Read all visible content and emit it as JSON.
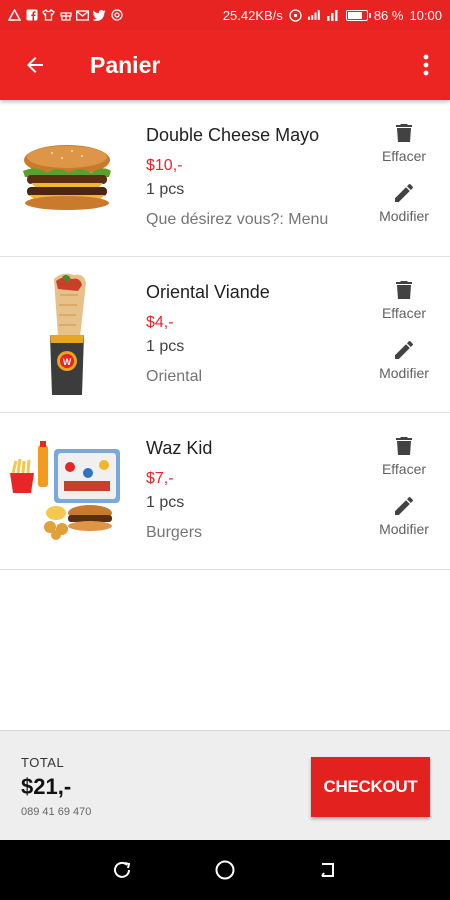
{
  "status_bar": {
    "speed": "25.42KB/s",
    "battery_text": "86 %",
    "battery_level": 0.86,
    "time": "10:00",
    "icons": [
      "warning-icon",
      "facebook-icon",
      "shirt-icon",
      "gift-icon",
      "mail-icon",
      "twitter-icon",
      "at-icon"
    ]
  },
  "app_bar": {
    "title": "Panier",
    "back_icon": "arrow-back-icon",
    "menu_icon": "more-vert-icon"
  },
  "items": [
    {
      "name": "Double Cheese Mayo",
      "price": "$10,-",
      "qty": "1 pcs",
      "note": "Que désirez vous?: Menu",
      "delete_label": "Effacer",
      "edit_label": "Modifier",
      "image": "burger-image"
    },
    {
      "name": "Oriental Viande",
      "price": "$4,-",
      "qty": "1 pcs",
      "note": "Oriental",
      "delete_label": "Effacer",
      "edit_label": "Modifier",
      "image": "wrap-image"
    },
    {
      "name": "Waz Kid",
      "price": "$7,-",
      "qty": "1 pcs",
      "note": "Burgers",
      "delete_label": "Effacer",
      "edit_label": "Modifier",
      "image": "kids-meal-image"
    }
  ],
  "footer": {
    "total_label": "TOTAL",
    "total_value": "$21,-",
    "phone": "089 41 69 470",
    "checkout_label": "CHECKOUT"
  },
  "colors": {
    "primary": "#ec2523",
    "price": "#e8262a",
    "checkout": "#e3211e"
  }
}
